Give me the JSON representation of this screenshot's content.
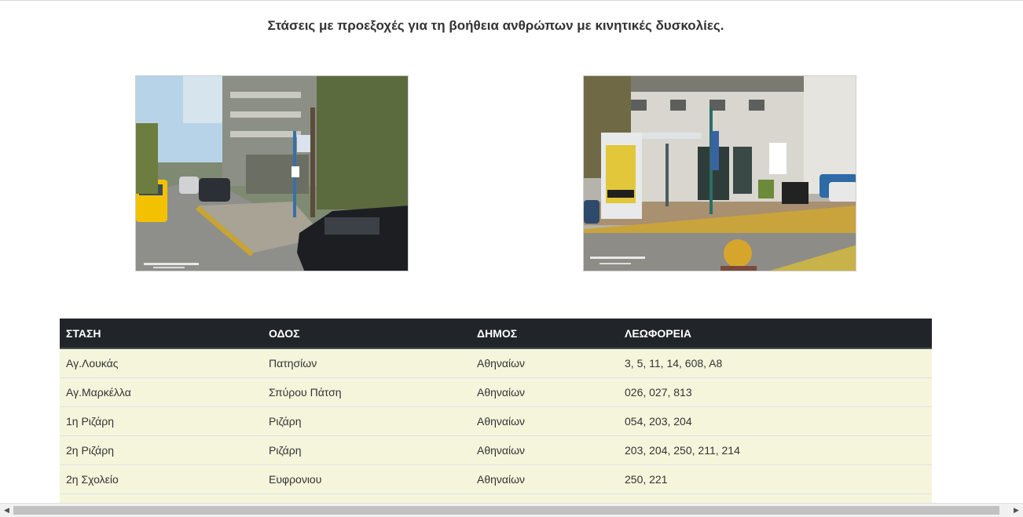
{
  "heading": "Στάσεις με προεξοχές για τη βοήθεια ανθρώπων με κινητικές δυσκολίες.",
  "photos": [
    {
      "label": "ΔΙΠΕ / ΤΜΗΜΑ ΥΛΙΚΟΥ ΥΠΟΔ. ΣΤΑΣΕΩΝ"
    },
    {
      "label": "ΔΙΠΕ / ΤΜΗΜΑ ΥΛΙΚΟΥ ΥΠΟΔ. ΣΤΑΣΕΩΝ"
    }
  ],
  "table": {
    "headers": [
      "ΣΤΑΣΗ",
      "ΟΔΟΣ",
      "ΔΗΜΟΣ",
      "ΛΕΩΦΟΡΕΙΑ"
    ],
    "rows": [
      [
        "Αγ.Λουκάς",
        "Πατησίων",
        "Αθηναίων",
        "3, 5, 11, 14, 608, Α8"
      ],
      [
        "Αγ.Μαρκέλλα",
        "Σπύρου Πάτση",
        "Αθηναίων",
        "026, 027, 813"
      ],
      [
        "1η Ριζάρη",
        "Ριζάρη",
        "Αθηναίων",
        "054, 203, 204"
      ],
      [
        "2η Ριζάρη",
        "Ριζάρη",
        "Αθηναίων",
        "203, 204, 250, 211, 214"
      ],
      [
        "2η Σχολείο",
        "Ευφρονιου",
        "Αθηναίων",
        "250, 221"
      ],
      [
        "",
        "",
        "",
        ""
      ]
    ]
  },
  "scrollbar": {
    "left_arrow": "◀",
    "right_arrow": "▶"
  },
  "colors": {
    "header_bg": "#212529",
    "row_bg": "#f5f5dc"
  }
}
